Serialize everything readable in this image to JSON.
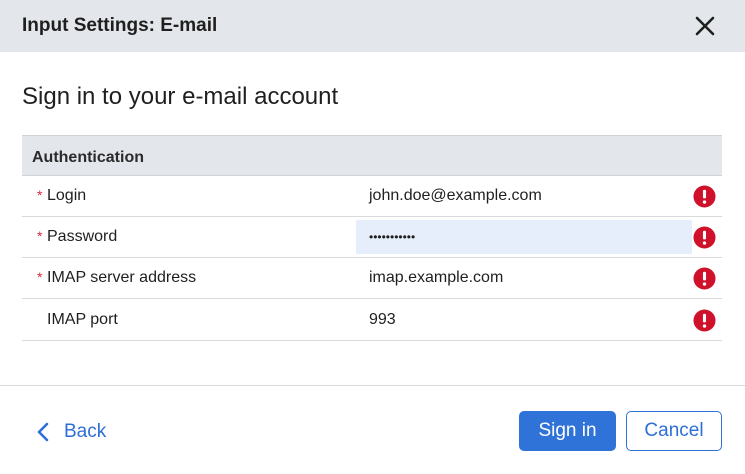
{
  "dialog": {
    "title": "Input Settings: E-mail",
    "heading": "Sign in to your e-mail account"
  },
  "section": {
    "title": "Authentication"
  },
  "fields": [
    {
      "label": "Login",
      "required": "*",
      "value": "john.doe@example.com",
      "error": true
    },
    {
      "label": "Password",
      "required": "*",
      "value": "•••••••••••",
      "error": true,
      "focused": true
    },
    {
      "label": "IMAP server address",
      "required": "*",
      "value": "imap.example.com",
      "error": true
    },
    {
      "label": "IMAP port",
      "required": "",
      "value": "993",
      "error": true
    }
  ],
  "footer": {
    "back_label": "Back",
    "signin_label": "Sign in",
    "cancel_label": "Cancel"
  },
  "colors": {
    "accent": "#2f72d8",
    "error": "#d0112b",
    "required": "#d6283a",
    "header_bg": "#e3e6ea"
  },
  "icons": {
    "close": "close-icon",
    "error": "error-icon",
    "back": "chevron-left-icon"
  }
}
